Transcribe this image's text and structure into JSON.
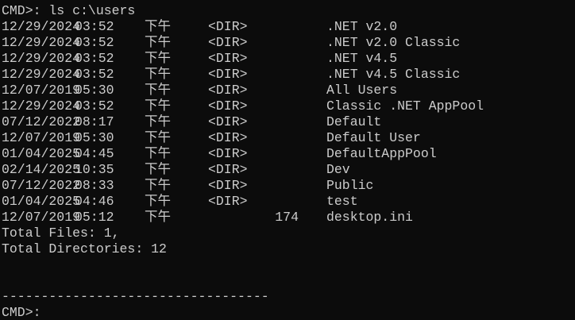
{
  "terminal": {
    "command_line": "CMD>: ls c:\\users",
    "entries": [
      {
        "date": "12/29/2024",
        "time": "03:52",
        "ampm": "下午",
        "type": "<DIR>",
        "size": "",
        "name": ".NET v2.0"
      },
      {
        "date": "12/29/2024",
        "time": "03:52",
        "ampm": "下午",
        "type": "<DIR>",
        "size": "",
        "name": ".NET v2.0 Classic"
      },
      {
        "date": "12/29/2024",
        "time": "03:52",
        "ampm": "下午",
        "type": "<DIR>",
        "size": "",
        "name": ".NET v4.5"
      },
      {
        "date": "12/29/2024",
        "time": "03:52",
        "ampm": "下午",
        "type": "<DIR>",
        "size": "",
        "name": ".NET v4.5 Classic"
      },
      {
        "date": "12/07/2019",
        "time": "05:30",
        "ampm": "下午",
        "type": "<DIR>",
        "size": "",
        "name": "All Users"
      },
      {
        "date": "12/29/2024",
        "time": "03:52",
        "ampm": "下午",
        "type": "<DIR>",
        "size": "",
        "name": "Classic .NET AppPool"
      },
      {
        "date": "07/12/2022",
        "time": "08:17",
        "ampm": "下午",
        "type": "<DIR>",
        "size": "",
        "name": "Default"
      },
      {
        "date": "12/07/2019",
        "time": "05:30",
        "ampm": "下午",
        "type": "<DIR>",
        "size": "",
        "name": "Default User"
      },
      {
        "date": "01/04/2025",
        "time": "04:45",
        "ampm": "下午",
        "type": "<DIR>",
        "size": "",
        "name": "DefaultAppPool"
      },
      {
        "date": "02/14/2025",
        "time": "10:35",
        "ampm": "下午",
        "type": "<DIR>",
        "size": "",
        "name": "Dev"
      },
      {
        "date": "07/12/2022",
        "time": "08:33",
        "ampm": "下午",
        "type": "<DIR>",
        "size": "",
        "name": "Public"
      },
      {
        "date": "01/04/2025",
        "time": "04:46",
        "ampm": "下午",
        "type": "<DIR>",
        "size": "",
        "name": "test"
      },
      {
        "date": "12/07/2019",
        "time": "05:12",
        "ampm": "下午",
        "type": "",
        "size": "174",
        "name": "desktop.ini"
      }
    ],
    "total_files": "Total Files: 1,",
    "total_directories": "Total Directories: 12",
    "divider": "----------------------------------",
    "prompt": "CMD>:",
    "input_value": ""
  },
  "colors": {
    "background": "#0c0c0c",
    "foreground": "#cccccc"
  }
}
